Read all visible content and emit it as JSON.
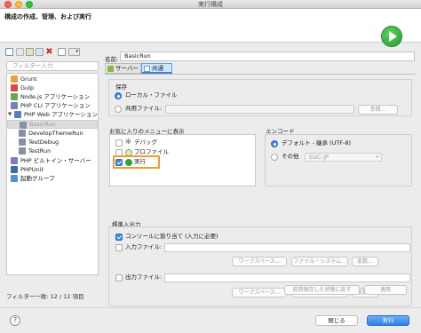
{
  "window": {
    "title": "実行構成"
  },
  "banner": {
    "title": "構成の作成、管理、および実行",
    "icon": "run-icon"
  },
  "left": {
    "filter_placeholder": "フィルター入力",
    "tree": [
      {
        "label": "Grunt",
        "icon": "grunt-icon",
        "color": "#e8a23a"
      },
      {
        "label": "Gulp",
        "icon": "gulp-icon",
        "color": "#d34a47"
      },
      {
        "label": "Node.js アプリケーション",
        "icon": "nodejs-icon",
        "color": "#6aa84f"
      },
      {
        "label": "PHP CLI アプリケーション",
        "icon": "php-icon",
        "color": "#7b7fb5"
      },
      {
        "label": "PHP Web アプリケーション",
        "icon": "php-web-icon",
        "color": "#5a7fbf"
      },
      {
        "label": "BasicRun",
        "icon": "config-icon",
        "color": "#8a8fa8"
      },
      {
        "label": "DevelopThemeRun",
        "icon": "config-icon",
        "color": "#8a8fa8"
      },
      {
        "label": "TestDebug",
        "icon": "config-icon",
        "color": "#8a8fa8"
      },
      {
        "label": "TestRun",
        "icon": "config-icon",
        "color": "#8a8fa8"
      },
      {
        "label": "PHP ビルトイン・サーバー",
        "icon": "php-server-icon",
        "color": "#7b7fb5"
      },
      {
        "label": "PHPUnit",
        "icon": "phpunit-icon",
        "color": "#3f6aa8"
      },
      {
        "label": "起動グループ",
        "icon": "launch-group-icon",
        "color": "#5a8fcf"
      }
    ],
    "filter_count": "フィルター一致: 12 / 12 項目"
  },
  "right": {
    "name_label": "名前:",
    "name_value": "BasicRun",
    "tabs": [
      {
        "label": "サーバー",
        "icon": "server-icon"
      },
      {
        "label": "共通",
        "icon": "common-icon"
      }
    ],
    "save": {
      "label": "保存",
      "local": "ローカル・ファイル",
      "shared": "共用ファイル:",
      "browse": "参照..."
    },
    "favorites": {
      "label": "お気に入りのメニューに表示",
      "items": [
        {
          "label": "デバッグ",
          "icon": "debug-icon",
          "checked": false
        },
        {
          "label": "プロファイル",
          "icon": "profile-icon",
          "checked": false
        },
        {
          "label": "実行",
          "icon": "run-icon",
          "checked": true
        }
      ]
    },
    "encoding": {
      "label": "エンコード",
      "default": "デフォルト - 継承 (UTF-8)",
      "other": "その他",
      "other_value": "EUC-JP"
    },
    "io": {
      "label": "標準入出力",
      "console": "コンソールに割り当て (入力に必要)",
      "input_file": "入力ファイル:",
      "output_file": "出力ファイル:",
      "workspace": "ワークスペース...",
      "filesystem": "ファイル・システム...",
      "variables": "変数..."
    },
    "revert": "前回保存した状態に戻す",
    "apply": "適用"
  },
  "bottom": {
    "help": "?",
    "close": "閉じる",
    "run": "実行"
  },
  "colors": {
    "accent": "#3b87e0",
    "highlight": "#f29a2e",
    "run_green": "#1e9b2a"
  }
}
